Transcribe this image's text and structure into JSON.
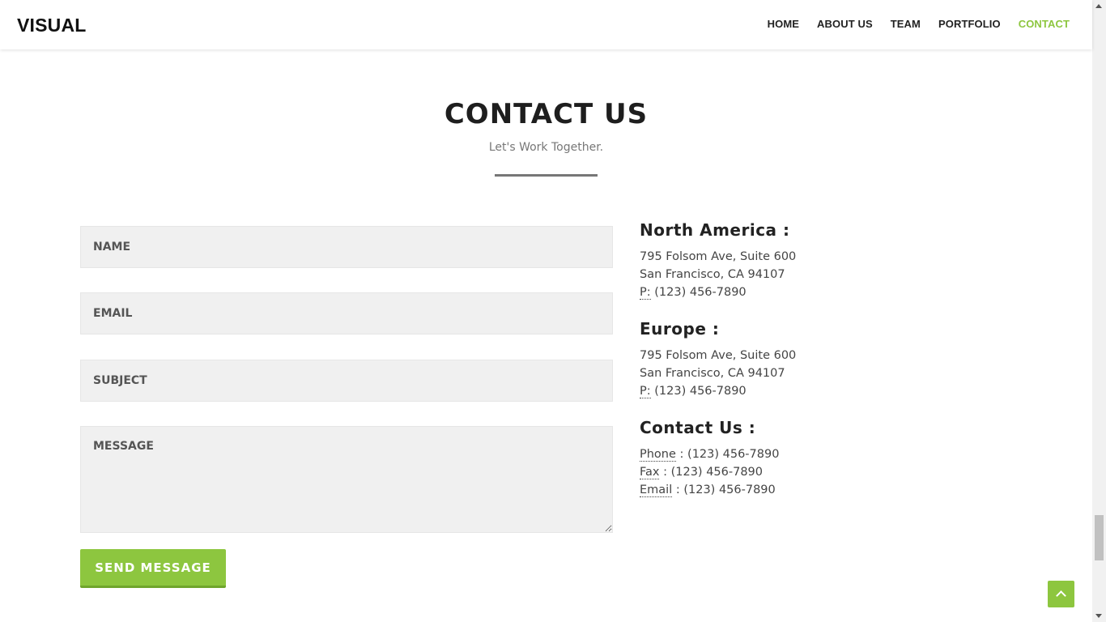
{
  "brand": {
    "logo": "VISUAL"
  },
  "nav": {
    "items": [
      {
        "label": "HOME"
      },
      {
        "label": "ABOUT US"
      },
      {
        "label": "TEAM"
      },
      {
        "label": "PORTFOLIO"
      },
      {
        "label": "CONTACT",
        "active": true
      }
    ],
    "accent_color": "#8dc63f"
  },
  "section": {
    "title": "CONTACT US",
    "subtitle": "Let's Work Together."
  },
  "form": {
    "name_placeholder": "NAME",
    "email_placeholder": "EMAIL",
    "subject_placeholder": "SUBJECT",
    "message_placeholder": "MESSAGE",
    "submit_label": "SEND MESSAGE"
  },
  "offices": {
    "north_america": {
      "heading": "North America :",
      "line1": "795 Folsom Ave, Suite 600",
      "line2": "San Francisco, CA 94107",
      "phone_abbr": "P:",
      "phone": "(123) 456-7890"
    },
    "europe": {
      "heading": "Europe :",
      "line1": "795 Folsom Ave, Suite 600",
      "line2": "San Francisco, CA 94107",
      "phone_abbr": "P:",
      "phone": "(123) 456-7890"
    }
  },
  "contact": {
    "heading": "Contact Us :",
    "phone_label": "Phone",
    "phone": "(123) 456-7890",
    "fax_label": "Fax",
    "fax": "(123) 456-7890",
    "email_label": "Email",
    "email": "(123) 456-7890"
  },
  "icons": {
    "back_to_top": "chevron-up-icon"
  }
}
